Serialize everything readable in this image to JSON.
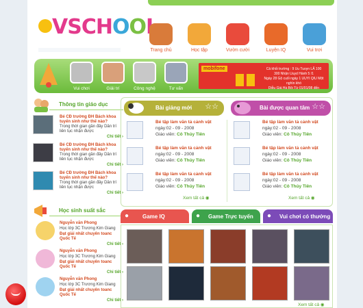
{
  "logo": {
    "text_v": "V",
    "text_school": "SCH",
    "o1": "O",
    "o2": "O",
    "l": "L"
  },
  "topnav": [
    {
      "label": "Trang chủ",
      "icon": "house-icon",
      "color": "#d97b3a"
    },
    {
      "label": "Học tập",
      "icon": "globe-pencil-icon",
      "color": "#f2a83a"
    },
    {
      "label": "Vườn cười",
      "icon": "clown-icon",
      "color": "#e94b3c"
    },
    {
      "label": "Luyện IQ",
      "icon": "books-icon",
      "color": "#e86a2a"
    },
    {
      "label": "Vui trơi",
      "icon": "globe-icon",
      "color": "#4aa0d8"
    }
  ],
  "banner_links": [
    {
      "label": "Vui chơi",
      "color": "#bfbfbf"
    },
    {
      "label": "Giải trí",
      "color": "#d9a07a"
    },
    {
      "label": "Công nghệ",
      "color": "#c8c8c8"
    },
    {
      "label": "Tư vấn",
      "color": "#9aa5b8"
    }
  ],
  "ad": {
    "brand": "mobifone",
    "lines": [
      "Cả khối trường : 9 Uu Tuoyn LẤ 100",
      "300 Nhận Uuyd Hành 5 /1",
      "Ngày 28 Gộ cuối ngày 1 UUYI QIU Một nghìn khó",
      "Diễu Giá Hà Bội Từ 01/01/08 đến 29.02.08"
    ]
  },
  "news": {
    "title": "Thông tin giáo dục",
    "items": [
      {
        "title": "Bé CĐ trường ĐH Bách khoa tuyển sinh như thế nào?",
        "desc": "Trong thời gian gần đây Dân trí liên tục nhận được",
        "more": "Chi tiết ›"
      },
      {
        "title": "Bé CĐ trường ĐH Bách khoa tuyển sinh như thế nào?",
        "desc": "Trong thời gian gần đây Dân trí liên tục nhận được",
        "more": "Chi tiết ›"
      },
      {
        "title": "Bé CĐ trường ĐH Bách khoa tuyển sinh như thế nào?",
        "desc": "Trong thời gian gần đây Dân trí liên tục nhận được",
        "more": "Chi tiết ›"
      }
    ]
  },
  "students": {
    "title": "Học sinh suất sắc",
    "items": [
      {
        "name": "Nguyễn văn Phong",
        "class": "Học lớp 3C Trương Kim Giang",
        "award": "Đạt giải nhất chuyên toanc Quốc Tế",
        "more": "Chi tiết ›"
      },
      {
        "name": "Nguyễn văn Phong",
        "class": "Học lớp 3C Trương Kim Giang",
        "award": "Đạt giải nhất chuyên toanc Quốc Tế",
        "more": "Chi tiết ›"
      },
      {
        "name": "Nguyễn văn Phong",
        "class": "Học lớp 3C Trương Kim Giang",
        "award": "Đạt giải nhất chuyên toanc Quốc Tế",
        "more": "Chi tiết ›"
      }
    ]
  },
  "lessons_new": {
    "title": "Bài giảng mới",
    "color": "#b5b13a",
    "view_all": "Xem tất cả",
    "items": [
      {
        "title": "Bé tập làm văn tả cảnh vật",
        "date": "ngày:02 - 09 - 2008",
        "teacher_label": "Giáo viên:",
        "teacher": "Cô Thủy Tiên"
      },
      {
        "title": "Bé tập làm văn tả cảnh vật",
        "date": "ngày:02 - 09 - 2008",
        "teacher_label": "Giáo viên:",
        "teacher": "Cô Thủy Tiên"
      },
      {
        "title": "Bé tập làm văn tả cảnh vật",
        "date": "ngày:02 - 09 - 2008",
        "teacher_label": "Giáo viên:",
        "teacher": "Cô Thủy Tiên"
      }
    ]
  },
  "lessons_popular": {
    "title": "Bài được quan tâm",
    "color": "#c04fa8",
    "view_all": "Xem tất cả",
    "items": [
      {
        "title": "Bé tập làm văn tả cảnh vật",
        "date": "ngày:02 - 09 - 2008",
        "teacher_label": "Giáo viên:",
        "teacher": "Cô Thủy Tiên"
      },
      {
        "title": "Bé tập làm văn tả cảnh vật",
        "date": "ngày:02 - 09 - 2008",
        "teacher_label": "Giáo viên:",
        "teacher": "Cô Thủy Tiên"
      },
      {
        "title": "Bé tập làm văn tả cảnh vật",
        "date": "ngày:02 - 09 - 2008",
        "teacher_label": "Giáo viên:",
        "teacher": "Cô Thủy Tiên"
      }
    ]
  },
  "game_tabs": [
    {
      "label": "Game IQ",
      "color": "#e8554f"
    },
    {
      "label": "Game Trực tuyến",
      "color": "#3ea34c"
    },
    {
      "label": "Vui chơi có thưởng",
      "color": "#7c4bb8"
    }
  ],
  "games": {
    "view_all": "Xem tất cả",
    "tiles": [
      "#6b5d58",
      "#c9742e",
      "#8a3d2a",
      "#5a5060",
      "#3d4f5c",
      "#9aa0a8",
      "#1e2a3a",
      "#a05a2c",
      "#b23a22",
      "#7a6a8a"
    ]
  }
}
